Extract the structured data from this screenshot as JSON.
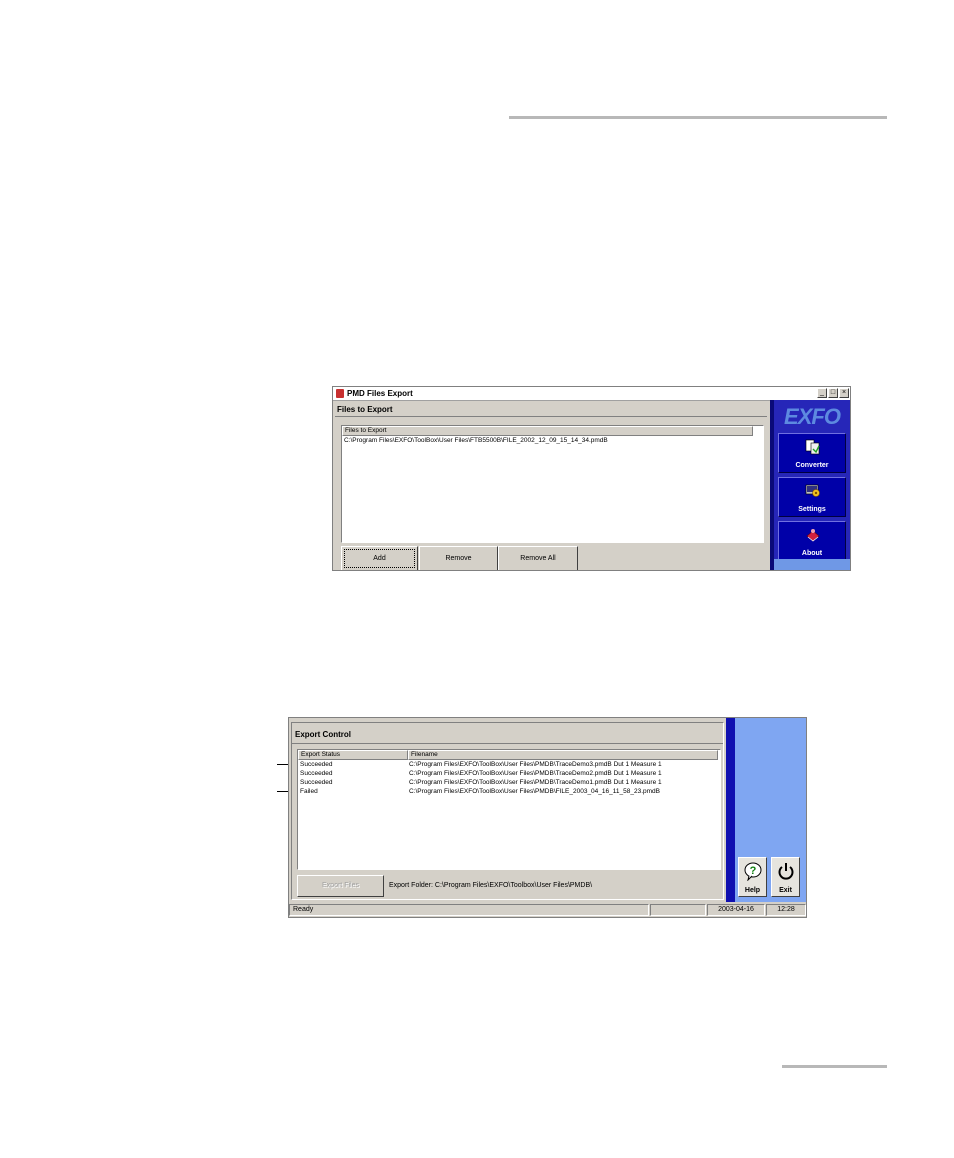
{
  "window1": {
    "title": "PMD Files Export",
    "controls": {
      "minimize": "_",
      "maximize": "□",
      "close": "×"
    },
    "section_title": "Files to Export",
    "list_header": "Files to Export",
    "files": [
      "C:\\Program Files\\EXFO\\ToolBox\\User Files\\FTB5500B\\FILE_2002_12_09_15_14_34.pmdB"
    ],
    "buttons": {
      "add": "Add",
      "remove": "Remove",
      "remove_all": "Remove All"
    },
    "sidebar": {
      "logo": "EXFO",
      "items": [
        {
          "label": "Converter",
          "icon": "converter-icon"
        },
        {
          "label": "Settings",
          "icon": "settings-icon"
        },
        {
          "label": "About",
          "icon": "about-icon"
        }
      ]
    }
  },
  "window2": {
    "section_title": "Export Control",
    "columns": {
      "status": "Export Status",
      "filename": "Filename"
    },
    "rows": [
      {
        "status": "Succeeded",
        "filename": "C:\\Program Files\\EXFO\\ToolBox\\User Files\\PMDB\\TraceDemo3.pmdB Dut 1 Measure 1"
      },
      {
        "status": "Succeeded",
        "filename": "C:\\Program Files\\EXFO\\ToolBox\\User Files\\PMDB\\TraceDemo2.pmdB Dut 1 Measure 1"
      },
      {
        "status": "Succeeded",
        "filename": "C:\\Program Files\\EXFO\\ToolBox\\User Files\\PMDB\\TraceDemo1.pmdB Dut 1 Measure 1"
      },
      {
        "status": "Failed",
        "filename": "C:\\Program Files\\EXFO\\ToolBox\\User Files\\PMDB\\FILE_2003_04_16_11_58_23.pmdB"
      }
    ],
    "export_button": "Export Files",
    "export_folder": "Export Folder: C:\\Program Files\\EXFO\\Toolbox\\User Files\\PMDB\\",
    "side_buttons": {
      "help": "Help",
      "exit": "Exit"
    },
    "status_bar": {
      "message": "Ready",
      "date": "2003-04-16",
      "time": "12:28"
    }
  },
  "colors": {
    "sidebar_blue": "#0000a8",
    "sidebar_light": "#7fa6f2",
    "window_gray": "#d4d0c8"
  }
}
